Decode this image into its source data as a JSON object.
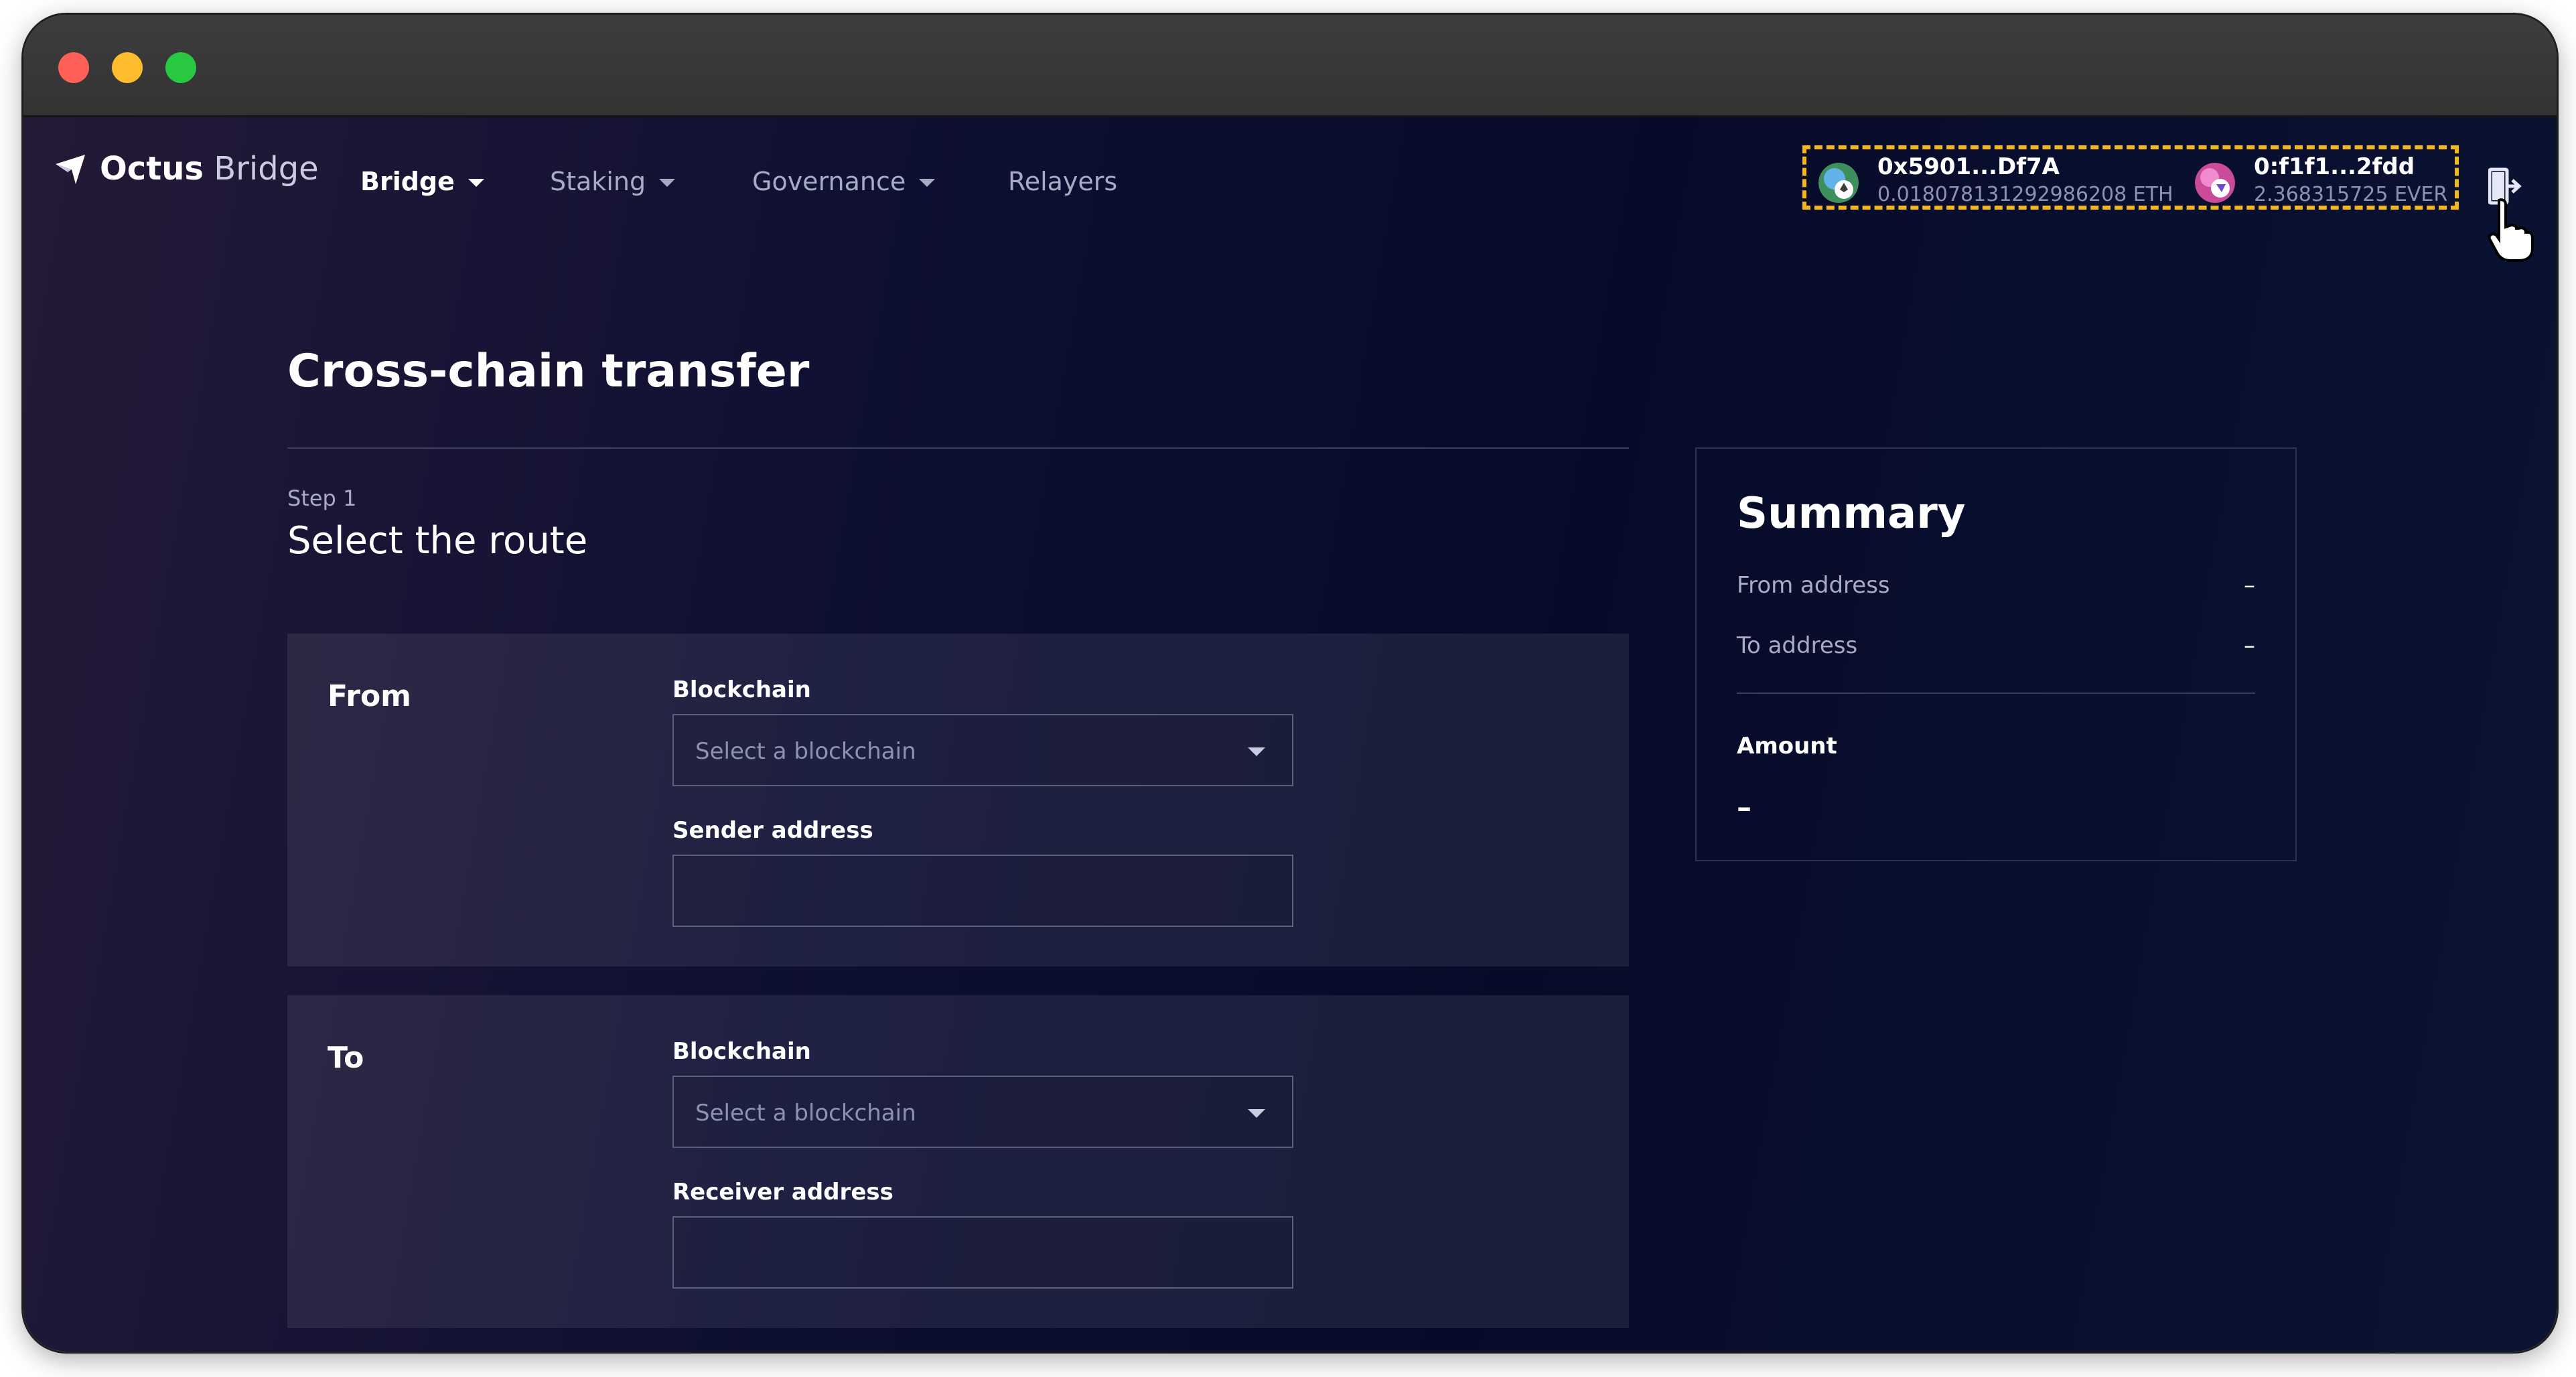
{
  "app": {
    "brand_bold": "Octus",
    "brand_light": "Bridge"
  },
  "nav": {
    "items": [
      {
        "label": "Bridge",
        "has_dropdown": true,
        "active": true
      },
      {
        "label": "Staking",
        "has_dropdown": true,
        "active": false
      },
      {
        "label": "Governance",
        "has_dropdown": true,
        "active": false
      },
      {
        "label": "Relayers",
        "has_dropdown": false,
        "active": false
      }
    ]
  },
  "wallets": [
    {
      "address": "0x5901...Df7A",
      "balance": "0.018078131292986208 ETH",
      "icon": "ethereum-wallet-icon"
    },
    {
      "address": "0:f1f1...2fdd",
      "balance": "2.368315725 EVER",
      "icon": "everscale-wallet-icon"
    }
  ],
  "page": {
    "title": "Cross-chain transfer",
    "step_label": "Step 1",
    "step_title": "Select the route"
  },
  "from_panel": {
    "title": "From",
    "blockchain_label": "Blockchain",
    "blockchain_placeholder": "Select a blockchain",
    "address_label": "Sender address",
    "address_value": ""
  },
  "to_panel": {
    "title": "To",
    "blockchain_label": "Blockchain",
    "blockchain_placeholder": "Select a blockchain",
    "address_label": "Receiver address",
    "address_value": ""
  },
  "summary": {
    "title": "Summary",
    "from_address_label": "From address",
    "from_address_value": "–",
    "to_address_label": "To address",
    "to_address_value": "–",
    "amount_label": "Amount",
    "amount_value": "–"
  },
  "colors": {
    "highlight_border": "#f3b817",
    "background": "#070b2a",
    "muted_text": "#a7abc4"
  }
}
